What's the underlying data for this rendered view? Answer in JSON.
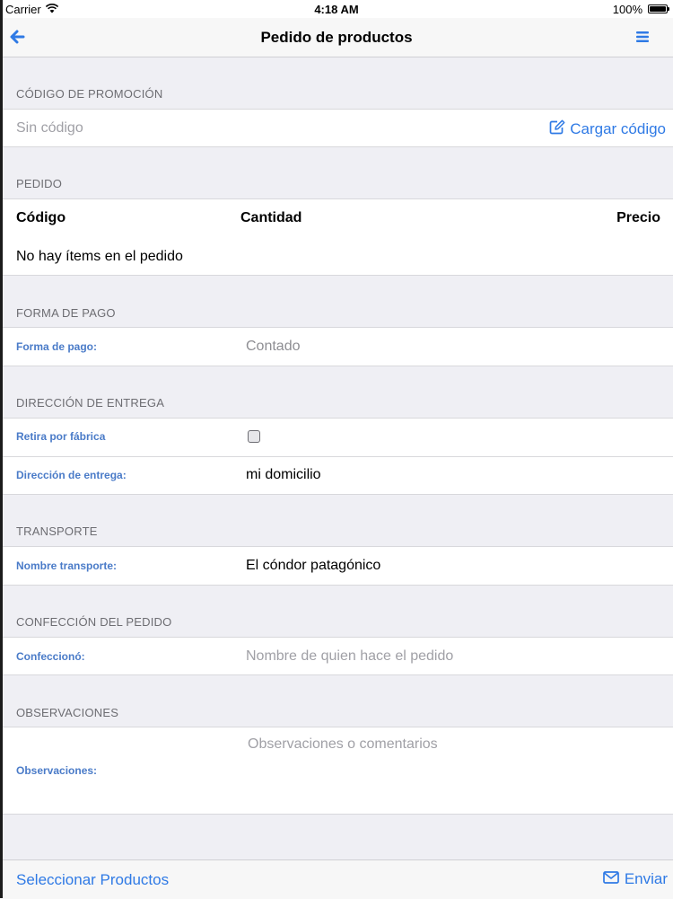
{
  "status_bar": {
    "carrier": "Carrier",
    "time": "4:18 AM",
    "battery": "100%"
  },
  "nav": {
    "title": "Pedido de productos"
  },
  "promo": {
    "header": "CÓDIGO DE PROMOCIÓN",
    "placeholder": "Sin código",
    "load_button": "Cargar código"
  },
  "order": {
    "header": "PEDIDO",
    "columns": [
      "Código",
      "Cantidad",
      "Precio"
    ],
    "empty_message": "No hay ítems en el pedido"
  },
  "payment": {
    "header": "FORMA DE PAGO",
    "label": "Forma de pago:",
    "value": "Contado"
  },
  "delivery": {
    "header": "DIRECCIÓN DE ENTREGA",
    "pickup_label": "Retira por fábrica",
    "pickup_checked": false,
    "address_label": "Dirección de entrega:",
    "address_value": "mi domicilio"
  },
  "transport": {
    "header": "TRANSPORTE",
    "label": "Nombre transporte:",
    "value": "El cóndor patagónico"
  },
  "prepared": {
    "header": "CONFECCIÓN DEL PEDIDO",
    "label": "Confeccionó:",
    "placeholder": "Nombre de quien hace el pedido"
  },
  "notes": {
    "header": "OBSERVACIONES",
    "label": "Observaciones:",
    "placeholder": "Observaciones o comentarios"
  },
  "toolbar": {
    "select_products": "Seleccionar Productos",
    "send": "Enviar"
  },
  "colors": {
    "accent": "#2f7ae5",
    "label": "#4a7bc8",
    "background": "#efeff4"
  }
}
